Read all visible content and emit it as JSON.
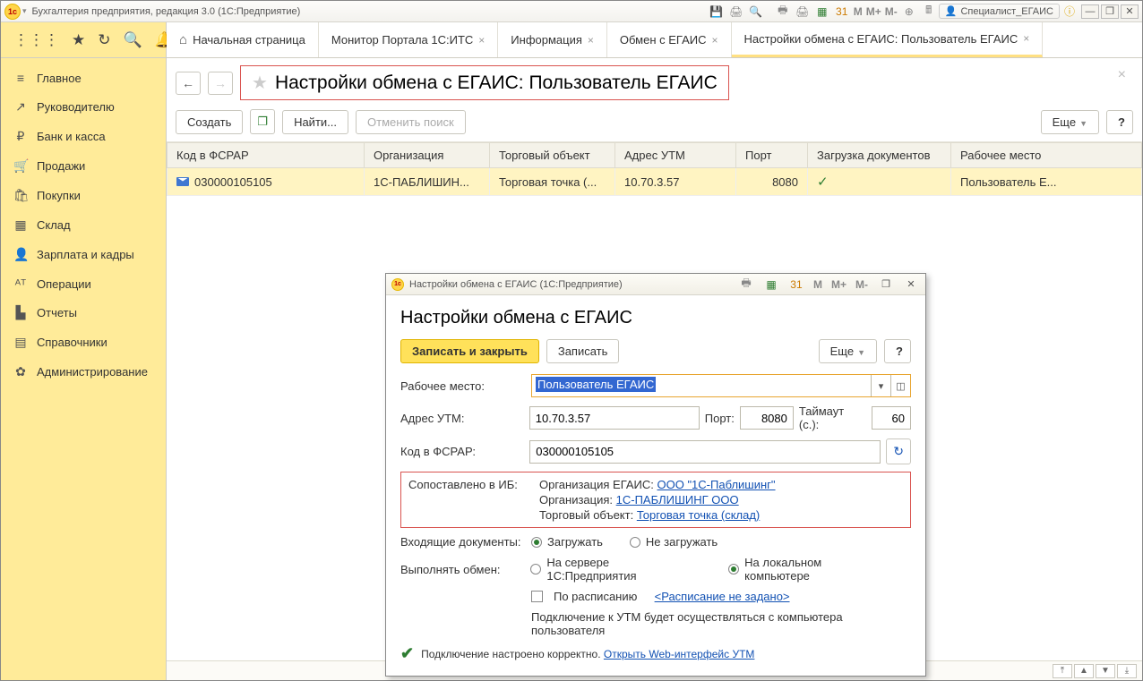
{
  "app": {
    "title": "Бухгалтерия предприятия, редакция 3.0  (1С:Предприятие)",
    "user": "Специалист_ЕГАИС"
  },
  "toolbar_top": {
    "s_mnemonics": [
      "M",
      "M+",
      "M-"
    ]
  },
  "tabs": [
    {
      "label": "Начальная страница",
      "closable": false,
      "icon": "home"
    },
    {
      "label": "Монитор Портала 1С:ИТС",
      "closable": true
    },
    {
      "label": "Информация",
      "closable": true
    },
    {
      "label": "Обмен с ЕГАИС",
      "closable": true
    },
    {
      "label": "Настройки обмена с ЕГАИС: Пользователь ЕГАИС",
      "closable": true,
      "active": true
    }
  ],
  "sidebar": {
    "items": [
      {
        "icon": "≡",
        "label": "Главное"
      },
      {
        "icon": "↗",
        "label": "Руководителю"
      },
      {
        "icon": "₽",
        "label": "Банк и касса"
      },
      {
        "icon": "🛒",
        "label": "Продажи"
      },
      {
        "icon": "🛍",
        "label": "Покупки"
      },
      {
        "icon": "▦",
        "label": "Склад"
      },
      {
        "icon": "👤",
        "label": "Зарплата и кадры"
      },
      {
        "icon": "ᴬᵀ",
        "label": "Операции"
      },
      {
        "icon": "▙",
        "label": "Отчеты"
      },
      {
        "icon": "▤",
        "label": "Справочники"
      },
      {
        "icon": "✿",
        "label": "Администрирование"
      }
    ]
  },
  "page": {
    "title": "Настройки обмена с ЕГАИС: Пользователь ЕГАИС",
    "actions": {
      "create": "Создать",
      "find": "Найти...",
      "cancel_search": "Отменить поиск",
      "more": "Еще",
      "help": "?"
    }
  },
  "table": {
    "columns": [
      "Код в ФСРАР",
      "Организация",
      "Торговый объект",
      "Адрес УТМ",
      "Порт",
      "Загрузка документов",
      "Рабочее место"
    ],
    "rows": [
      {
        "code": "030000105105",
        "org": "1С-ПАБЛИШИН...",
        "shop": "Торговая точка (...",
        "utm": "10.70.3.57",
        "port": "8080",
        "load": "✓",
        "place": "Пользователь Е..."
      }
    ]
  },
  "dialog": {
    "window_title": "Настройки обмена с ЕГАИС  (1С:Предприятие)",
    "heading": "Настройки обмена с ЕГАИС",
    "btn_save_close": "Записать и закрыть",
    "btn_save": "Записать",
    "btn_more": "Еще",
    "btn_help": "?",
    "lbl_workplace": "Рабочее место:",
    "workplace": "Пользователь ЕГАИС",
    "lbl_utm": "Адрес УТМ:",
    "utm": "10.70.3.57",
    "lbl_port": "Порт:",
    "port": "8080",
    "lbl_timeout": "Таймаут (с.):",
    "timeout": "60",
    "lbl_fsrar": "Код в ФСРАР:",
    "fsrar": "030000105105",
    "lbl_matched": "Сопоставлено в ИБ:",
    "matched_org_egais_lbl": "Организация ЕГАИС: ",
    "matched_org_egais_link": "ООО \"1С-Паблишинг\"",
    "matched_org_lbl": "Организация: ",
    "matched_org_link": "1С-ПАБЛИШИНГ ООО",
    "matched_shop_lbl": "Торговый объект: ",
    "matched_shop_link": "Торговая точка (склад)",
    "lbl_incoming": "Входящие документы:",
    "opt_load": "Загружать",
    "opt_noload": "Не загружать",
    "lbl_exchange": "Выполнять обмен:",
    "opt_server": "На сервере 1С:Предприятия",
    "opt_local": "На локальном компьютере",
    "chk_schedule": "По расписанию",
    "schedule_link": "<Расписание не задано>",
    "note": "Подключение к УТМ будет осуществляться с компьютера пользователя",
    "ok_text": "Подключение настроено корректно. ",
    "utm_web_link": "Открыть Web-интерфейс УТМ"
  }
}
